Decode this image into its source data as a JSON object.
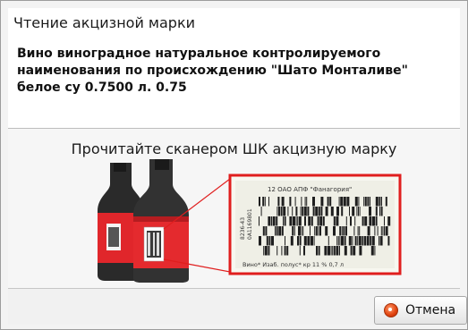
{
  "window": {
    "title": "Чтение акцизной марки"
  },
  "product": {
    "name": "Вино виноградное натуральное контролируемого наименования по происхождению \"Шато Монталиве\" белое су 0.7500 л. 0.75"
  },
  "main": {
    "instruction": "Прочитайте сканером ШК акцизную марку"
  },
  "stamp": {
    "header": "12 ОАО АПФ \"Фанагория\"",
    "side_code": "8236-43",
    "side_number": "0A1169801",
    "footer": "Вино* Изаб. полус* кр 11 % 0,7 л"
  },
  "footer": {
    "cancel_label": "Отмена"
  },
  "colors": {
    "bottle_red": "#e0262b",
    "bottle_dark": "#2a2a2a",
    "highlight_frame": "#e01e1e",
    "cancel_icon": "#e0420e"
  },
  "icons": {
    "cancel": "record-icon"
  }
}
